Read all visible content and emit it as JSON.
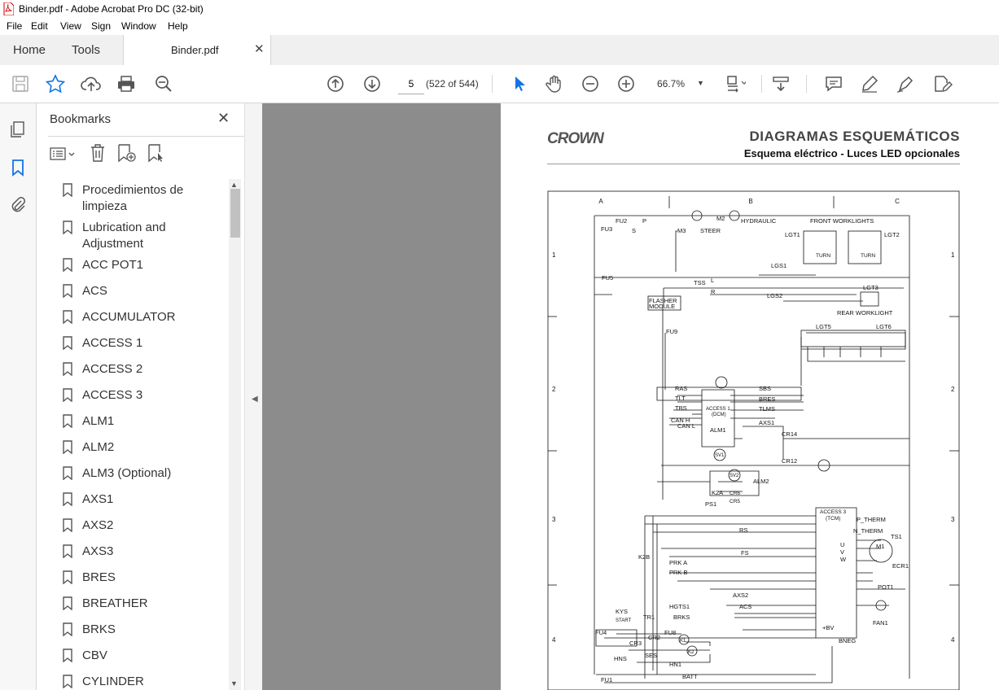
{
  "window": {
    "title": "Binder.pdf - Adobe Acrobat Pro DC (32-bit)"
  },
  "menu": [
    "File",
    "Edit",
    "View",
    "Sign",
    "Window",
    "Help"
  ],
  "tabs": {
    "home": "Home",
    "tools": "Tools",
    "document": "Binder.pdf"
  },
  "toolbar": {
    "page_current": "5",
    "page_count": "(522 of 544)",
    "zoom": "66.7%"
  },
  "bookmarks": {
    "title": "Bookmarks",
    "items": [
      "Procedimientos de limpieza",
      "Lubrication and Adjustment",
      "ACC POT1",
      "ACS",
      "ACCUMULATOR",
      "ACCESS 1",
      "ACCESS 2",
      "ACCESS 3",
      "ALM1",
      "ALM2",
      "ALM3 (Optional)",
      "AXS1",
      "AXS2",
      "AXS3",
      "BRES",
      "BREATHER",
      "BRKS",
      "CBV",
      "CYLINDER"
    ]
  },
  "document": {
    "logo": "CROWN",
    "heading": "DIAGRAMAS ESQUEMÁTICOS",
    "subheading": "Esquema eléctrico - Luces LED opcionales",
    "columns": [
      "A",
      "B",
      "C"
    ],
    "rows": [
      "1",
      "2",
      "3",
      "4"
    ],
    "labels": {
      "fu2": "FU2",
      "fu3": "FU3",
      "p": "P",
      "s": "S",
      "m3": "M3",
      "steer": "STEER",
      "m2": "M2",
      "hydraulic": "HYDRAULIC",
      "front_worklights": "FRONT WORKLIGHTS",
      "lgt1": "LGT1",
      "lgt2": "LGT2",
      "turn": "TURN",
      "lgs1": "LGS1",
      "fu5": "FU5",
      "tss": "TSS",
      "l": "L",
      "r": "R",
      "lgs2": "LGS2",
      "lgt3": "LGT3",
      "rear_worklight": "REAR WORKLIGHT",
      "flasher": "FLASHER",
      "module": "MODULE",
      "fu9": "FU9",
      "lgt5": "LGT5",
      "lgt6": "LGT6",
      "ras": "RAS",
      "tlt": "TLT",
      "tbs": "TBS",
      "can_h": "CAN H",
      "can_l": "CAN L",
      "access1": "ACCESS 1",
      "dcm": "(DCM)",
      "alm1": "ALM1",
      "sbs": "SBS",
      "bres": "BRES",
      "tlms": "TLMS",
      "axs1": "AXS1",
      "sv1": "SV1",
      "cr14": "CR14",
      "cr12": "CR12",
      "sv2": "SV2",
      "alm2": "ALM2",
      "k2a": "K2A",
      "cr6": "CR6",
      "cr5": "CR5",
      "ps1": "PS1",
      "access3": "ACCESS 3",
      "tcm": "(TCM)",
      "p_therm": "P_THERM",
      "n_therm": "N_THERM",
      "ts1": "TS1",
      "m1": "M1",
      "u": "U",
      "v": "V",
      "w": "W",
      "ecr1": "ECR1",
      "pot1": "POT1",
      "fan1": "FAN1",
      "rs": "RS",
      "fs": "FS",
      "k2b": "K2B",
      "prk_a": "PRK A",
      "prk_b": "PRK B",
      "axs2": "AXS2",
      "acs": "ACS",
      "hgts1": "HGTS1",
      "brks": "BRKS",
      "kys": "KYS",
      "start": "START",
      "tr1": "TR1",
      "fu4": "FU4",
      "cr2": "CR2",
      "fu8": "FU8",
      "cr3": "CR3",
      "k1": "K1",
      "k2": "K2",
      "ses": "SES",
      "hns": "HNS",
      "hn1": "HN1",
      "bv": "+BV",
      "bneg": "BNEG",
      "fu1": "FU1",
      "batt": "BATT"
    }
  }
}
